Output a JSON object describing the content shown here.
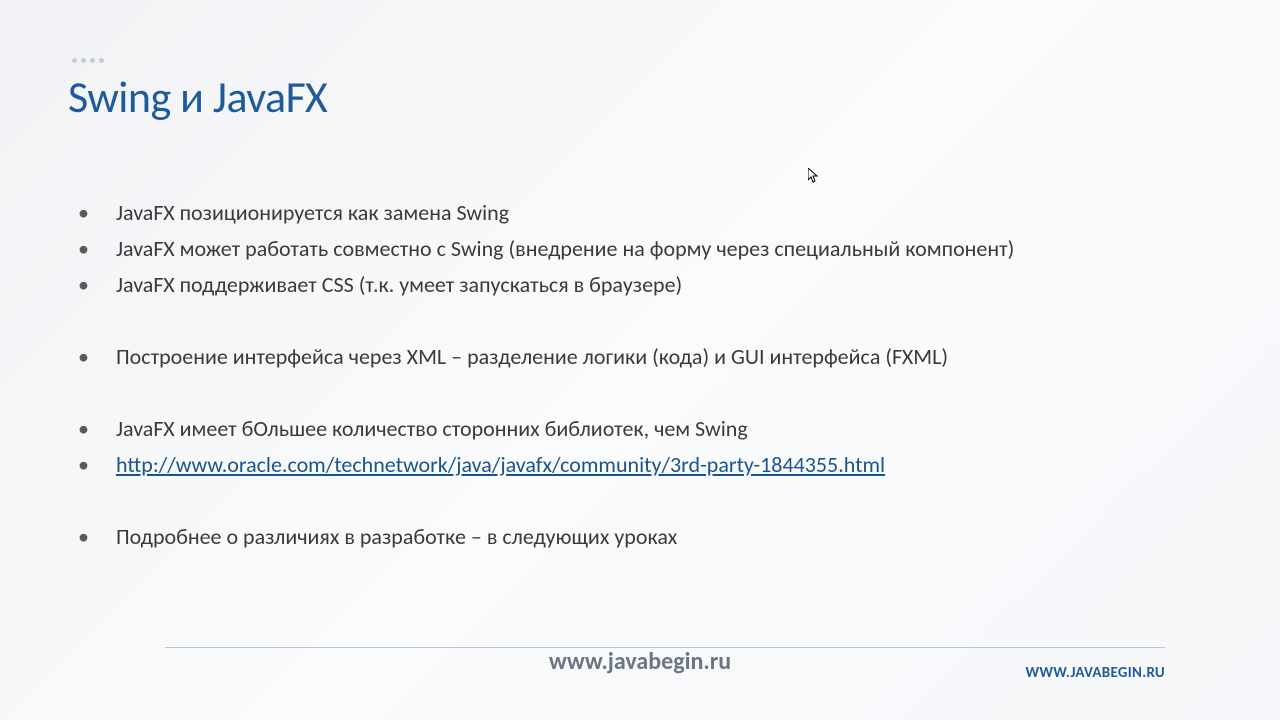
{
  "title": "Swing и JavaFX",
  "bullets": {
    "b1": "JavaFX позиционируется как замена Swing",
    "b2": "JavaFX может работать совместно с Swing (внедрение на форму через специальный компонент)",
    "b3": "JavaFX поддерживает CSS (т.к. умеет запускаться в браузере)",
    "b4": "Построение интерфейса через XML – разделение логики (кода) и GUI интерфейса (FXML)",
    "b5": "JavaFX имеет бОльшее количество сторонних библиотек, чем Swing",
    "b6": "http://www.oracle.com/technetwork/java/javafx/community/3rd-party-1844355.html",
    "b7": "Подробнее о различиях в разработке – в следующих уроках"
  },
  "footer": {
    "center": "www.javabegin.ru",
    "right": "WWW.JAVABEGIN.RU"
  }
}
